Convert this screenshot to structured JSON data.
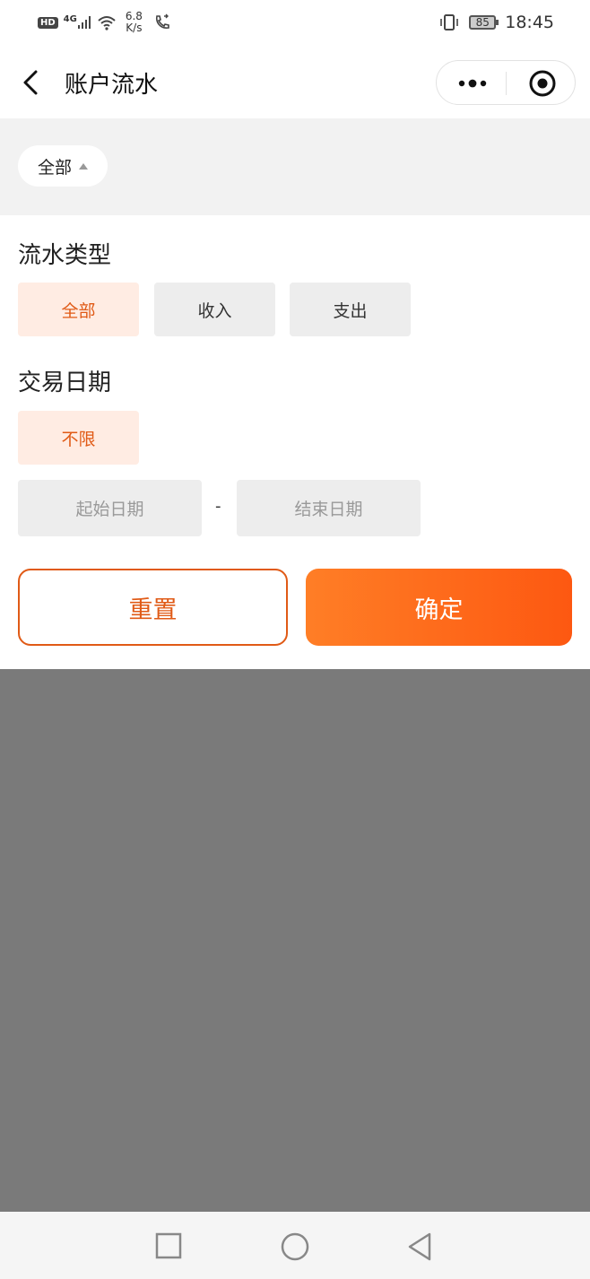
{
  "status_bar": {
    "hd_label": "HD",
    "network_label": "4G",
    "speed_value": "6.8",
    "speed_unit": "K/s",
    "battery_level": "85",
    "time": "18:45"
  },
  "nav": {
    "title": "账户流水"
  },
  "filter_bar": {
    "dropdown_label": "全部"
  },
  "flow_type": {
    "title": "流水类型",
    "options": [
      {
        "label": "全部",
        "active": true
      },
      {
        "label": "收入",
        "active": false
      },
      {
        "label": "支出",
        "active": false
      }
    ]
  },
  "trade_date": {
    "title": "交易日期",
    "unlimited_label": "不限",
    "start_placeholder": "起始日期",
    "separator": "-",
    "end_placeholder": "结束日期"
  },
  "actions": {
    "reset_label": "重置",
    "confirm_label": "确定"
  },
  "colors": {
    "accent": "#e05a16",
    "confirm_gradient_start": "#ff7e26",
    "confirm_gradient_end": "#fd5811",
    "active_option_bg": "#ffece3",
    "overlay": "#7a7a7a"
  }
}
